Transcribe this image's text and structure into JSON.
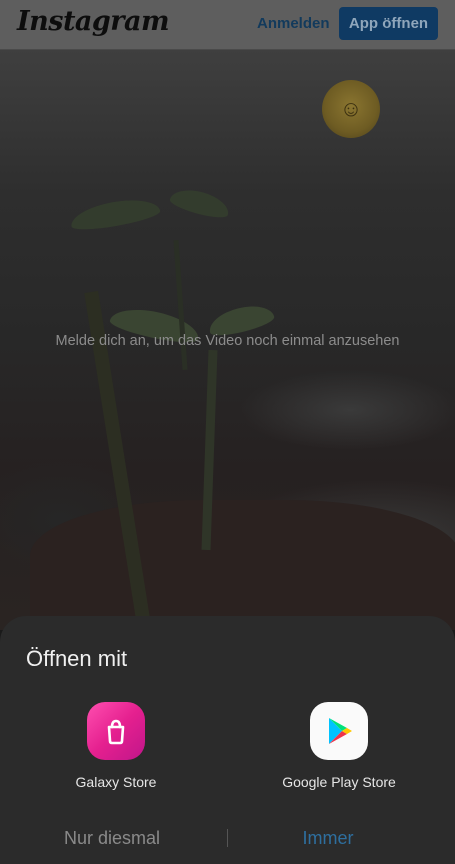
{
  "header": {
    "logo_text": "Instagram",
    "login_label": "Anmelden",
    "open_app_label": "App öffnen"
  },
  "video": {
    "message": "Melde dich an, um das Video noch einmal anzusehen"
  },
  "sheet": {
    "title": "Öffnen mit",
    "apps": [
      {
        "label": "Galaxy Store",
        "icon": "shopping-bag-icon",
        "color": "#e5208f"
      },
      {
        "label": "Google Play Store",
        "icon": "play-triangle-icon",
        "color": "#fafafa"
      }
    ],
    "once_label": "Nur diesmal",
    "always_label": "Immer"
  },
  "colors": {
    "accent_blue": "#0f3a63",
    "always_blue": "#2e6f9f",
    "sheet_bg": "#2b2b2b"
  }
}
